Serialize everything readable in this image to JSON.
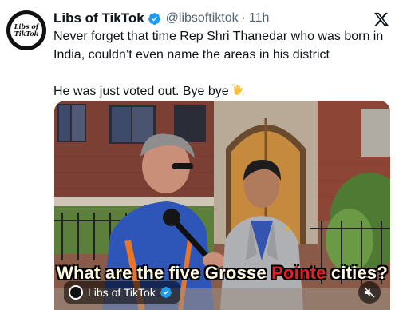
{
  "account": {
    "display_name": "Libs of TikTok",
    "handle": "@libsoftiktok",
    "separator": "·",
    "time": "11h",
    "avatar_text_line1": "Libs of",
    "avatar_text_line2": "TikTok"
  },
  "tweet": {
    "line1": "Never forget that time Rep Shri Thanedar who was born in India, couldn’t even name the areas in his district",
    "line2": "He was just voted out. Bye bye"
  },
  "media": {
    "caption_part1": "What are the five ",
    "caption_part2": "Grosse ",
    "caption_highlight": "Pointe",
    "caption_part3": " cities?",
    "badge_name": "Libs of TikTok"
  },
  "icons": {
    "verified": "verified-badge-icon",
    "platform": "x-logo-icon",
    "emoji": "waving-hand-icon",
    "mute": "muted-speaker-icon"
  },
  "colors": {
    "verified_blue": "#1d9bf0",
    "handle_gray": "#536471",
    "caption_highlight": "#e0202a"
  }
}
